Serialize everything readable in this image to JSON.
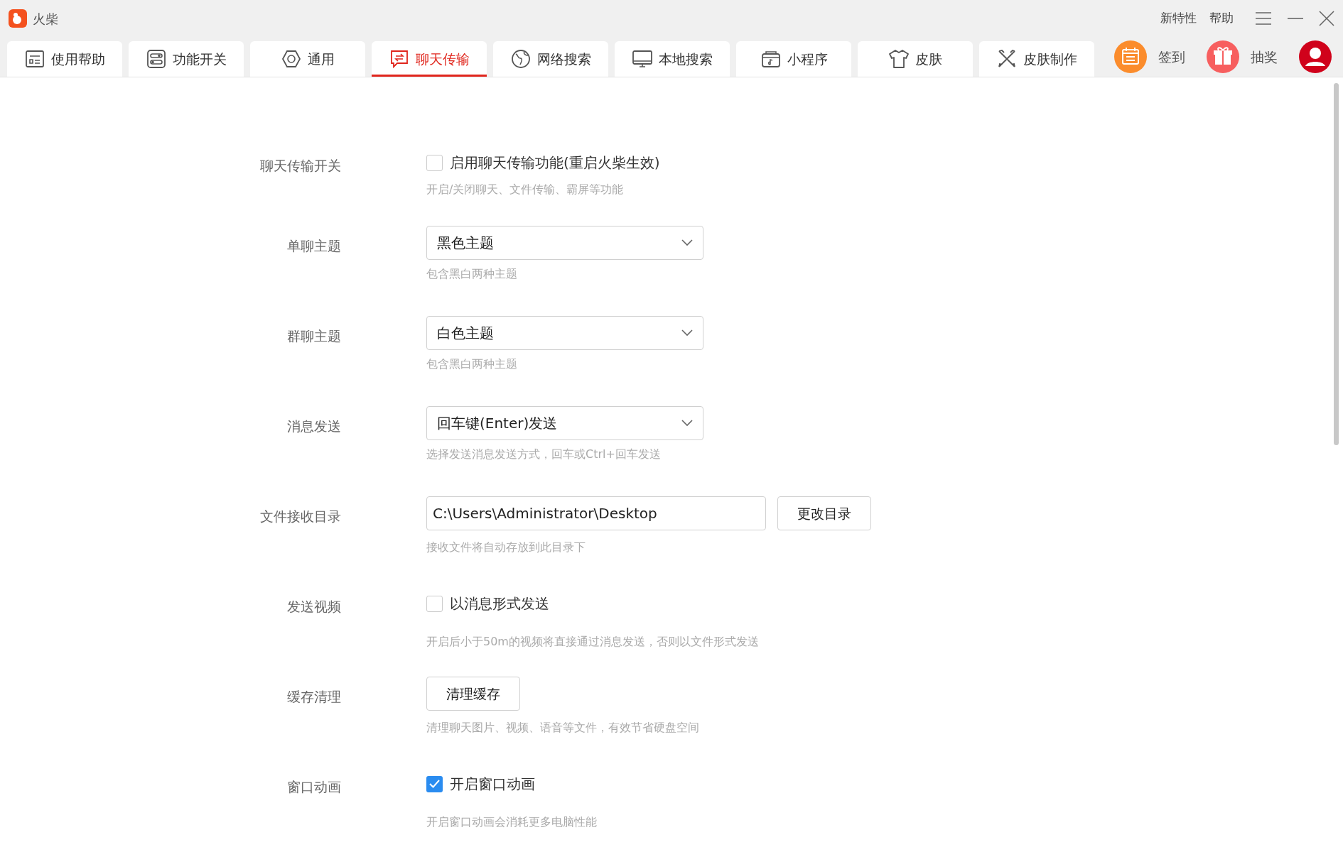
{
  "window": {
    "title": "火柴"
  },
  "top_links": [
    "新特性",
    "帮助"
  ],
  "tabs": [
    {
      "label": "使用帮助",
      "selected": false
    },
    {
      "label": "功能开关",
      "selected": false
    },
    {
      "label": "通用",
      "selected": false
    },
    {
      "label": "聊天传输",
      "selected": true
    },
    {
      "label": "网络搜索",
      "selected": false
    },
    {
      "label": "本地搜索",
      "selected": false
    },
    {
      "label": "小程序",
      "selected": false
    },
    {
      "label": "皮肤",
      "selected": false
    },
    {
      "label": "皮肤制作",
      "selected": false
    }
  ],
  "actions": [
    {
      "label": "签到",
      "color": "#fb8c2c"
    },
    {
      "label": "抽奖",
      "color": "#f75f5f"
    }
  ],
  "settings": [
    {
      "label": "聊天传输开关",
      "kind": "checkbox",
      "option": "启用聊天传输功能(重启火柴生效)",
      "checked": false,
      "hint": "开启/关闭聊天、文件传输、霸屏等功能"
    },
    {
      "label": "单聊主题",
      "kind": "select",
      "value": "黑色主题",
      "hint": "包含黑白两种主题"
    },
    {
      "label": "群聊主题",
      "kind": "select",
      "value": "白色主题",
      "hint": "包含黑白两种主题"
    },
    {
      "label": "消息发送",
      "kind": "select",
      "value": "回车键(Enter)发送",
      "hint": "选择发送消息发送方式，回车或Ctrl+回车发送"
    },
    {
      "label": "文件接收目录",
      "kind": "path",
      "value": "C:\\Users\\Administrator\\Desktop",
      "button": "更改目录",
      "hint": "接收文件将自动存放到此目录下"
    },
    {
      "label": "发送视频",
      "kind": "checkbox",
      "option": "以消息形式发送",
      "checked": false,
      "hint": "开启后小于50m的视频将直接通过消息发送，否则以文件形式发送"
    },
    {
      "label": "缓存清理",
      "kind": "button",
      "button": "清理缓存",
      "hint": "清理聊天图片、视频、语音等文件，有效节省硬盘空间"
    },
    {
      "label": "窗口动画",
      "kind": "checkbox",
      "option": "开启窗口动画",
      "checked": true,
      "hint": "开启窗口动画会消耗更多电脑性能"
    }
  ]
}
